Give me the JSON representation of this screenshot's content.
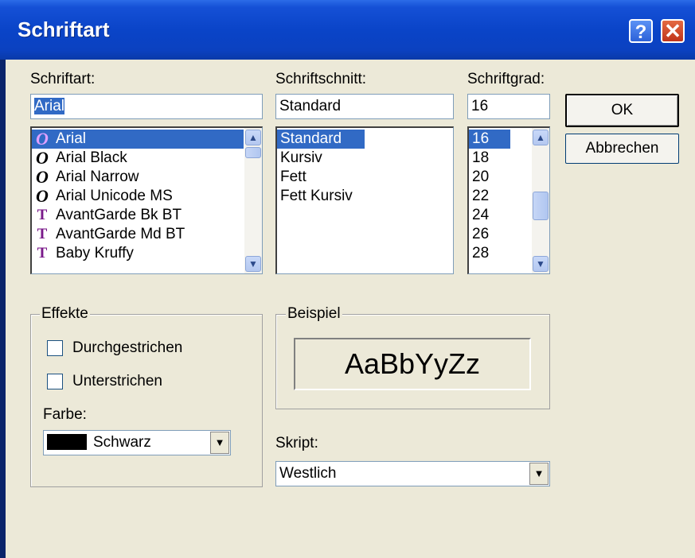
{
  "window": {
    "title": "Schriftart",
    "help_glyph": "?",
    "close_glyph": "✕"
  },
  "font": {
    "label": "Schriftart:",
    "value": "Arial",
    "items": [
      {
        "name": "Arial",
        "icon": "O",
        "selected": true
      },
      {
        "name": "Arial Black",
        "icon": "O"
      },
      {
        "name": "Arial Narrow",
        "icon": "O"
      },
      {
        "name": "Arial Unicode MS",
        "icon": "O"
      },
      {
        "name": "AvantGarde Bk BT",
        "icon": "T"
      },
      {
        "name": "AvantGarde Md BT",
        "icon": "T"
      },
      {
        "name": "Baby Kruffy",
        "icon": "T"
      }
    ]
  },
  "style": {
    "label": "Schriftschnitt:",
    "value": "Standard",
    "items": [
      "Standard",
      "Kursiv",
      "Fett",
      "Fett Kursiv"
    ]
  },
  "size": {
    "label": "Schriftgrad:",
    "value": "16",
    "items": [
      "16",
      "18",
      "20",
      "22",
      "24",
      "26",
      "28"
    ]
  },
  "buttons": {
    "ok": "OK",
    "cancel": "Abbrechen"
  },
  "effects": {
    "legend": "Effekte",
    "strikeout": "Durchgestrichen",
    "underline": "Unterstrichen",
    "color_label": "Farbe:",
    "color_value": "Schwarz"
  },
  "sample": {
    "legend": "Beispiel",
    "text": "AaBbYyZz"
  },
  "script": {
    "label": "Skript:",
    "value": "Westlich"
  },
  "colors": {
    "titlebar": "#0a44c8",
    "selection": "#316ac5",
    "dialog_bg": "#ece9d8"
  }
}
